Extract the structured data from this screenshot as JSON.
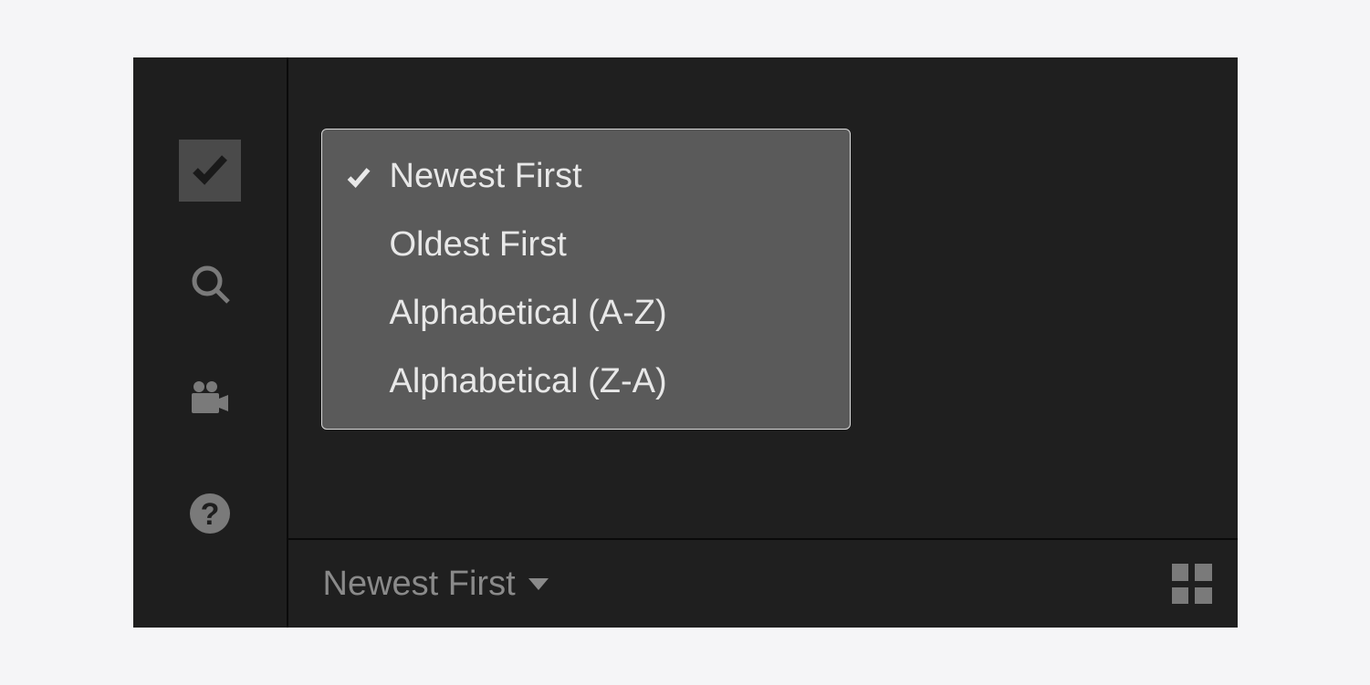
{
  "sortMenu": {
    "items": [
      {
        "label": "Newest First",
        "selected": true
      },
      {
        "label": "Oldest First",
        "selected": false
      },
      {
        "label": "Alphabetical (A-Z)",
        "selected": false
      },
      {
        "label": "Alphabetical (Z-A)",
        "selected": false
      }
    ]
  },
  "bottomBar": {
    "sortLabel": "Newest First"
  }
}
